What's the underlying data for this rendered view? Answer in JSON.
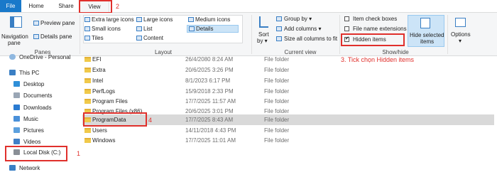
{
  "tabs": {
    "file": "File",
    "home": "Home",
    "share": "Share",
    "view": "View"
  },
  "ribbon": {
    "panes": {
      "navigation_pane_line1": "Navigation",
      "navigation_pane_line2": "pane",
      "preview_pane": "Preview pane",
      "details_pane": "Details pane",
      "group_label": "Panes"
    },
    "layout": {
      "extra_large_icons": "Extra large icons",
      "large_icons": "Large icons",
      "medium_icons": "Medium icons",
      "small_icons": "Small icons",
      "list": "List",
      "details": "Details",
      "tiles": "Tiles",
      "content": "Content",
      "group_label": "Layout"
    },
    "current_view": {
      "sort_by_line1": "Sort",
      "sort_by_line2": "by",
      "group_by": "Group by",
      "add_columns": "Add columns",
      "size_all_columns": "Size all columns to fit",
      "group_label": "Current view"
    },
    "show_hide": {
      "item_check_boxes": "Item check boxes",
      "file_name_extensions": "File name extensions",
      "hidden_items": "Hidden items",
      "hide_selected_line1": "Hide selected",
      "hide_selected_line2": "items",
      "group_label": "Show/hide"
    },
    "options": "Options"
  },
  "sidebar": {
    "items": [
      {
        "label": "OneDrive - Personal",
        "icon": "cloud-icon"
      },
      {
        "label": "This PC",
        "icon": "computer-icon"
      },
      {
        "label": "Desktop",
        "icon": "desktop-icon"
      },
      {
        "label": "Documents",
        "icon": "documents-icon"
      },
      {
        "label": "Downloads",
        "icon": "downloads-icon"
      },
      {
        "label": "Music",
        "icon": "music-icon"
      },
      {
        "label": "Pictures",
        "icon": "pictures-icon"
      },
      {
        "label": "Videos",
        "icon": "videos-icon"
      },
      {
        "label": "Local Disk (C:)",
        "icon": "drive-icon"
      },
      {
        "label": "Network",
        "icon": "network-icon"
      }
    ]
  },
  "files": [
    {
      "name": "EFI",
      "date": "26/4/2080 8:24 AM",
      "type": "File folder"
    },
    {
      "name": "Extra",
      "date": "20/6/2025 3:26 PM",
      "type": "File folder"
    },
    {
      "name": "Intel",
      "date": "8/1/2023 6:17 PM",
      "type": "File folder"
    },
    {
      "name": "PerfLogs",
      "date": "15/9/2018 2:33 PM",
      "type": "File folder"
    },
    {
      "name": "Program Files",
      "date": "17/7/2025 11:57 AM",
      "type": "File folder"
    },
    {
      "name": "Program Files (x86)",
      "date": "20/6/2025 3:01 PM",
      "type": "File folder"
    },
    {
      "name": "ProgramData",
      "date": "17/7/2025 8:43 AM",
      "type": "File folder"
    },
    {
      "name": "Users",
      "date": "14/11/2018 4:43 PM",
      "type": "File folder"
    },
    {
      "name": "Windows",
      "date": "17/7/2025 11:01 AM",
      "type": "File folder"
    }
  ],
  "annotations": {
    "step1": "1",
    "step2": "2",
    "step3": "3. Tick chọn Hidden items",
    "step4": "4"
  },
  "colors": {
    "accent": "#1979ca",
    "annotation": "#e0302c",
    "selected_row": "#d9d9d9"
  }
}
